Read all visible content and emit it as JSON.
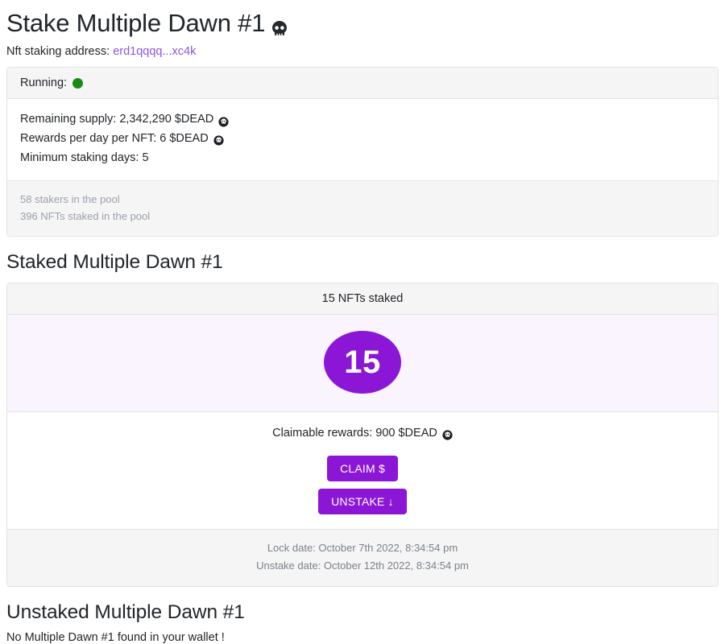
{
  "header": {
    "title": "Stake Multiple Dawn #1",
    "title_icon": "skull-icon",
    "address_label": "Nft staking address:",
    "address_value": "erd1qqqq...xc4k"
  },
  "pool_card": {
    "status_label": "Running:",
    "status_indicator": "green-dot-icon",
    "status_color": "#1a8a12",
    "stats": [
      {
        "text": "Remaining supply: 2,342,290 $DEAD",
        "icon": "dead-coin-icon"
      },
      {
        "text": "Rewards per day per NFT: 6 $DEAD",
        "icon": "dead-coin-icon"
      },
      {
        "text": "Minimum staking days: 5",
        "icon": ""
      }
    ],
    "footer_lines": [
      "58 stakers in the pool",
      "396 NFTs staked in the pool"
    ]
  },
  "staked_section": {
    "title": "Staked Multiple Dawn #1",
    "card_header": "15 NFTs staked",
    "badge_count": "15",
    "rewards_text": "Claimable rewards: 900 $DEAD",
    "rewards_icon": "dead-coin-icon",
    "claim_button": "CLAIM $",
    "unstake_button": "UNSTAKE ↓",
    "lock_date": "Lock date: October 7th 2022, 8:34:54 pm",
    "unstake_date": "Unstake date: October 12th 2022, 8:34:54 pm"
  },
  "unstaked_section": {
    "title": "Unstaked Multiple Dawn #1",
    "empty_message": "No Multiple Dawn #1 found in your wallet !"
  },
  "colors": {
    "purple": "#8b16d6",
    "link_purple": "#8c54e8",
    "tint": "#faf4ff",
    "panel": "#f5f5f6",
    "border": "#e3e4e6",
    "muted": "#9aa1a9",
    "green": "#1a8a12"
  }
}
